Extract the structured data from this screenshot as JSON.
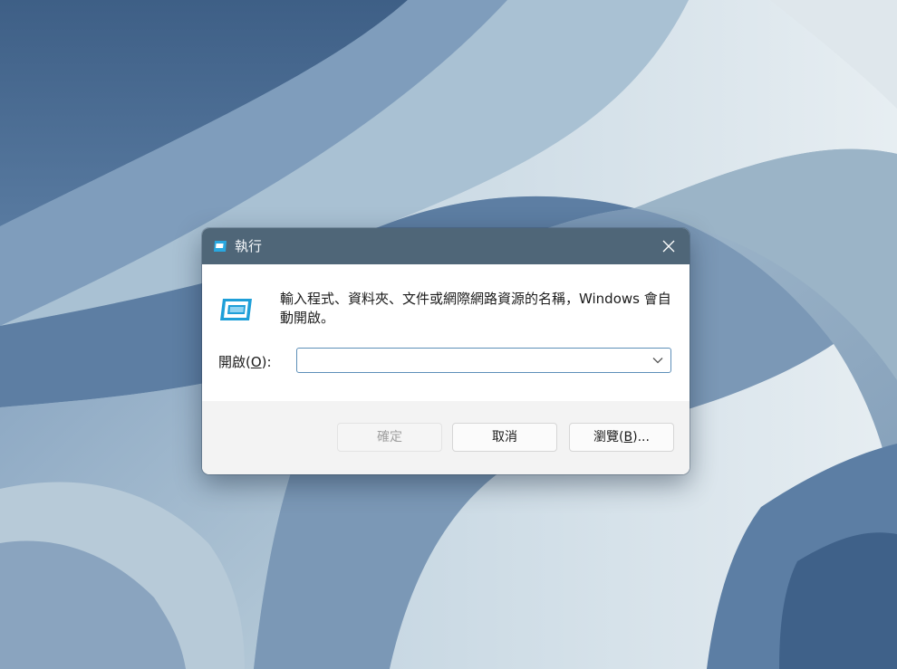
{
  "dialog": {
    "title": "執行",
    "description": "輸入程式、資料夾、文件或網際網路資源的名稱，Windows 會自動開啟。",
    "open_label_prefix": "開啟(",
    "open_label_accel": "O",
    "open_label_suffix": "):",
    "open_value": "",
    "buttons": {
      "ok": "確定",
      "cancel": "取消",
      "browse_prefix": "瀏覽(",
      "browse_accel": "B",
      "browse_suffix": ")..."
    }
  },
  "icons": {
    "title_icon": "run-app-icon",
    "main_icon": "run-app-icon",
    "close": "close-icon",
    "dropdown": "chevron-down-icon"
  },
  "colors": {
    "titlebar": "#4f6678",
    "focus_border": "#5d8fb8",
    "icon_accent": "#1e9fd8"
  }
}
